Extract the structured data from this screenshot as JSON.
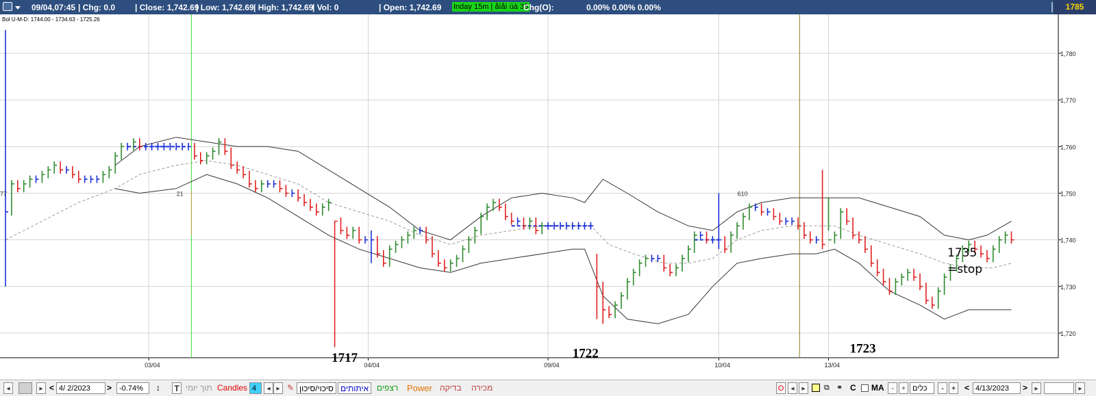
{
  "topbar": {
    "datetime": "09/04,07:45",
    "change": "| Chg: 0.0",
    "close": "| Close: 1,742.69",
    "low": "| Low: 1,742.69",
    "high": "| High: 1,742.69",
    "vol": "| Vol: 0",
    "open": "| Open: 1,742.69",
    "interval_badge": "Inday 15m | åìåì úà 35",
    "chg_o_label": "Chg(O):",
    "chg_o_values": "0.00% 0.00% 0.00%",
    "last_price": "1785"
  },
  "indicator_legend": "Bol U-M-D: 1744.00 - 1734.63 - 1725.26",
  "chart_data": {
    "type": "candlestick",
    "interval": "15m",
    "y_ticks": [
      "1,720",
      "1,730",
      "1,740",
      "1,750",
      "1,760",
      "1,770",
      "1,780"
    ],
    "ylim": [
      1713,
      1787
    ],
    "x_date_labels": [
      "03/04",
      "04/04",
      "09/04",
      "10/04",
      "13/04"
    ],
    "series": [
      {
        "name": "Close",
        "points": [
          [
            0,
            1746
          ],
          [
            2,
            1752
          ],
          [
            4,
            1751
          ],
          [
            6,
            1752
          ],
          [
            8,
            1753
          ],
          [
            10,
            1753
          ],
          [
            12,
            1754
          ],
          [
            14,
            1755
          ],
          [
            16,
            1756
          ],
          [
            18,
            1755
          ],
          [
            20,
            1755
          ],
          [
            22,
            1754
          ],
          [
            24,
            1753
          ],
          [
            26,
            1753
          ],
          [
            28,
            1753
          ],
          [
            30,
            1753
          ],
          [
            32,
            1754
          ],
          [
            34,
            1755
          ],
          [
            36,
            1758
          ],
          [
            38,
            1760
          ],
          [
            40,
            1760
          ],
          [
            42,
            1761
          ],
          [
            44,
            1760
          ],
          [
            46,
            1760
          ],
          [
            48,
            1760
          ],
          [
            50,
            1760
          ],
          [
            52,
            1760
          ],
          [
            54,
            1760
          ],
          [
            56,
            1760
          ],
          [
            58,
            1760
          ],
          [
            60,
            1760
          ],
          [
            62,
            1758
          ],
          [
            64,
            1757
          ],
          [
            66,
            1758
          ],
          [
            68,
            1759
          ],
          [
            70,
            1761
          ],
          [
            72,
            1759
          ],
          [
            74,
            1756
          ],
          [
            76,
            1755
          ],
          [
            78,
            1754
          ],
          [
            80,
            1752
          ],
          [
            82,
            1751
          ],
          [
            84,
            1752
          ],
          [
            86,
            1752
          ],
          [
            88,
            1752
          ],
          [
            90,
            1751
          ],
          [
            92,
            1750
          ],
          [
            94,
            1750
          ],
          [
            96,
            1749
          ],
          [
            98,
            1748
          ],
          [
            100,
            1747
          ],
          [
            102,
            1746
          ],
          [
            104,
            1747
          ],
          [
            106,
            1748
          ],
          [
            108,
            1744
          ],
          [
            110,
            1742
          ],
          [
            112,
            1741
          ],
          [
            114,
            1742
          ],
          [
            116,
            1740
          ],
          [
            118,
            1740
          ],
          [
            120,
            1740
          ],
          [
            122,
            1737
          ],
          [
            124,
            1735
          ],
          [
            126,
            1738
          ],
          [
            128,
            1739
          ],
          [
            130,
            1740
          ],
          [
            132,
            1741
          ],
          [
            134,
            1742
          ],
          [
            136,
            1742
          ],
          [
            138,
            1740
          ],
          [
            140,
            1737
          ],
          [
            142,
            1735
          ],
          [
            144,
            1734
          ],
          [
            146,
            1735
          ],
          [
            148,
            1736
          ],
          [
            150,
            1738
          ],
          [
            152,
            1740
          ],
          [
            154,
            1742
          ],
          [
            156,
            1745
          ],
          [
            158,
            1747
          ],
          [
            160,
            1748
          ],
          [
            162,
            1747
          ],
          [
            164,
            1745
          ],
          [
            166,
            1744
          ],
          [
            168,
            1744
          ],
          [
            170,
            1743
          ],
          [
            172,
            1744
          ],
          [
            174,
            1742
          ],
          [
            176,
            1743
          ],
          [
            178,
            1743
          ],
          [
            180,
            1743
          ],
          [
            182,
            1743
          ],
          [
            184,
            1743
          ],
          [
            186,
            1743
          ],
          [
            188,
            1743
          ],
          [
            190,
            1743
          ],
          [
            192,
            1743
          ],
          [
            194,
            1730
          ],
          [
            196,
            1725
          ],
          [
            198,
            1724
          ],
          [
            200,
            1726
          ],
          [
            202,
            1728
          ],
          [
            204,
            1731
          ],
          [
            206,
            1733
          ],
          [
            208,
            1735
          ],
          [
            210,
            1736
          ],
          [
            212,
            1736
          ],
          [
            214,
            1736
          ],
          [
            216,
            1734
          ],
          [
            218,
            1733
          ],
          [
            220,
            1734
          ],
          [
            222,
            1736
          ],
          [
            224,
            1738
          ],
          [
            226,
            1741
          ],
          [
            228,
            1741
          ],
          [
            230,
            1740
          ],
          [
            232,
            1740
          ],
          [
            234,
            1740
          ],
          [
            236,
            1738
          ],
          [
            238,
            1741
          ],
          [
            240,
            1743
          ],
          [
            242,
            1745
          ],
          [
            244,
            1747
          ],
          [
            246,
            1747
          ],
          [
            248,
            1746
          ],
          [
            250,
            1746
          ],
          [
            252,
            1745
          ],
          [
            254,
            1744
          ],
          [
            256,
            1744
          ],
          [
            258,
            1744
          ],
          [
            260,
            1743
          ],
          [
            262,
            1741
          ],
          [
            264,
            1740
          ],
          [
            266,
            1740
          ],
          [
            268,
            1739
          ],
          [
            270,
            1740
          ],
          [
            272,
            1741
          ],
          [
            274,
            1746
          ],
          [
            276,
            1744
          ],
          [
            278,
            1741
          ],
          [
            280,
            1740
          ],
          [
            282,
            1738
          ],
          [
            284,
            1735
          ],
          [
            286,
            1733
          ],
          [
            288,
            1731
          ],
          [
            290,
            1729
          ],
          [
            292,
            1731
          ],
          [
            294,
            1732
          ],
          [
            296,
            1733
          ],
          [
            298,
            1732
          ],
          [
            300,
            1730
          ],
          [
            302,
            1727
          ],
          [
            304,
            1726
          ],
          [
            306,
            1729
          ],
          [
            308,
            1732
          ],
          [
            310,
            1734
          ],
          [
            312,
            1736
          ],
          [
            314,
            1738
          ],
          [
            316,
            1739
          ],
          [
            318,
            1738
          ],
          [
            320,
            1737
          ],
          [
            322,
            1736
          ],
          [
            324,
            1738
          ],
          [
            326,
            1740
          ],
          [
            328,
            1741
          ],
          [
            330,
            1740
          ]
        ]
      }
    ],
    "bollinger_upper": [
      [
        36,
        1756
      ],
      [
        44,
        1760
      ],
      [
        56,
        1762
      ],
      [
        66,
        1761
      ],
      [
        76,
        1760
      ],
      [
        86,
        1760
      ],
      [
        96,
        1759
      ],
      [
        106,
        1755
      ],
      [
        116,
        1751
      ],
      [
        126,
        1747
      ],
      [
        136,
        1742
      ],
      [
        146,
        1740
      ],
      [
        156,
        1745
      ],
      [
        166,
        1749
      ],
      [
        176,
        1750
      ],
      [
        186,
        1749
      ],
      [
        190,
        1748
      ],
      [
        196,
        1753
      ],
      [
        204,
        1750
      ],
      [
        214,
        1746
      ],
      [
        224,
        1743
      ],
      [
        232,
        1742
      ],
      [
        240,
        1746
      ],
      [
        248,
        1748
      ],
      [
        258,
        1749
      ],
      [
        266,
        1749
      ],
      [
        272,
        1749
      ],
      [
        280,
        1749
      ],
      [
        290,
        1747
      ],
      [
        300,
        1745
      ],
      [
        308,
        1741
      ],
      [
        316,
        1740
      ],
      [
        322,
        1741
      ],
      [
        330,
        1744
      ]
    ],
    "bollinger_middle": [
      [
        0,
        1740
      ],
      [
        12,
        1744
      ],
      [
        24,
        1748
      ],
      [
        36,
        1751
      ],
      [
        44,
        1754
      ],
      [
        56,
        1756
      ],
      [
        66,
        1757
      ],
      [
        76,
        1756
      ],
      [
        86,
        1754
      ],
      [
        96,
        1752
      ],
      [
        106,
        1748
      ],
      [
        116,
        1746
      ],
      [
        126,
        1744
      ],
      [
        136,
        1741
      ],
      [
        146,
        1739
      ],
      [
        156,
        1741
      ],
      [
        166,
        1742
      ],
      [
        176,
        1743
      ],
      [
        186,
        1743
      ],
      [
        192,
        1743
      ],
      [
        198,
        1739
      ],
      [
        206,
        1737
      ],
      [
        216,
        1735
      ],
      [
        224,
        1735
      ],
      [
        232,
        1736
      ],
      [
        240,
        1740
      ],
      [
        248,
        1742
      ],
      [
        258,
        1743
      ],
      [
        266,
        1743
      ],
      [
        272,
        1743
      ],
      [
        280,
        1741
      ],
      [
        290,
        1739
      ],
      [
        300,
        1737
      ],
      [
        308,
        1735
      ],
      [
        316,
        1734
      ],
      [
        324,
        1734
      ],
      [
        330,
        1735
      ]
    ],
    "bollinger_lower": [
      [
        36,
        1751
      ],
      [
        44,
        1750
      ],
      [
        56,
        1751
      ],
      [
        66,
        1754
      ],
      [
        76,
        1752
      ],
      [
        86,
        1749
      ],
      [
        96,
        1745
      ],
      [
        106,
        1741
      ],
      [
        116,
        1738
      ],
      [
        126,
        1736
      ],
      [
        136,
        1734
      ],
      [
        146,
        1733
      ],
      [
        156,
        1735
      ],
      [
        166,
        1736
      ],
      [
        176,
        1737
      ],
      [
        186,
        1738
      ],
      [
        190,
        1738
      ],
      [
        196,
        1728
      ],
      [
        204,
        1723
      ],
      [
        214,
        1722
      ],
      [
        224,
        1724
      ],
      [
        232,
        1730
      ],
      [
        240,
        1735
      ],
      [
        248,
        1736
      ],
      [
        258,
        1737
      ],
      [
        266,
        1737
      ],
      [
        272,
        1738
      ],
      [
        280,
        1735
      ],
      [
        290,
        1729
      ],
      [
        300,
        1726
      ],
      [
        308,
        1723
      ],
      [
        316,
        1725
      ],
      [
        322,
        1725
      ],
      [
        330,
        1725
      ]
    ],
    "annotations": [
      {
        "text": "1717",
        "x": 107,
        "y": 1715
      },
      {
        "text": "1722",
        "x": 186,
        "y": 1716
      },
      {
        "text": "1723",
        "x": 277,
        "y": 1717
      },
      {
        "text": "1735",
        "x": 309,
        "y": 1737
      },
      {
        "text": "=stop",
        "x": 309,
        "y": 1733.5
      }
    ],
    "small_labels": [
      {
        "text": "77",
        "x": 0,
        "y": 1750
      },
      {
        "text": "21",
        "x": 57,
        "y": 1750
      },
      {
        "text": "610",
        "x": 241,
        "y": 1750
      }
    ],
    "grid": true
  },
  "bottombar": {
    "date_value": "4/  2/2023",
    "pct_value": "-0.74%",
    "t_label": "T",
    "intraday_label": "תוך יומי",
    "candles_label": "Candles",
    "candles_value": "4",
    "btn_trade": "סיכוי/סיכון",
    "btn_signals": "איתותים",
    "btn_sequences": "רצפים",
    "btn_power": "Power",
    "btn_check": "בדיקה",
    "btn_sell": "מכירה",
    "o_label": "O",
    "c_label": "C",
    "ma_label": "MA",
    "all_select": "כלים",
    "end_date": "4/13/2023"
  }
}
